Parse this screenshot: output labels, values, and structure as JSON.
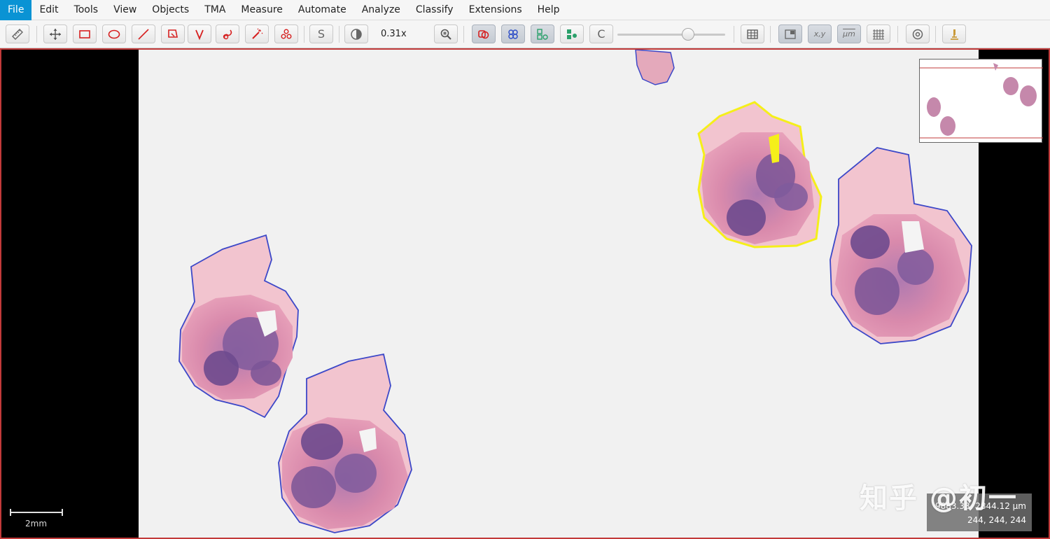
{
  "menu": {
    "items": [
      "File",
      "Edit",
      "Tools",
      "View",
      "Objects",
      "TMA",
      "Measure",
      "Automate",
      "Analyze",
      "Classify",
      "Extensions",
      "Help"
    ]
  },
  "toolbar": {
    "zoom": "0.31x",
    "s_label": "S",
    "c_label": "C",
    "xy_label": "x,y",
    "um_label": "μm",
    "brightness_level": 0.68
  },
  "viewer": {
    "scale_label": "2mm",
    "coord_xy": "9883.33, 2844.12 μm",
    "coord_rgb": "244, 244, 244",
    "watermark": "知乎 @初一"
  },
  "colors": {
    "accent": "#0a93d4",
    "viewer_border": "#c23a3a",
    "annotation_blue": "#3c48c8",
    "annotation_selected": "#f5ef1a",
    "tissue_pink": "#e59ab4",
    "tissue_purple": "#8d5d9e"
  },
  "icons": [
    "ruler-icon",
    "move-icon",
    "rectangle-icon",
    "ellipse-icon",
    "line-icon",
    "polygon-icon",
    "polyline-icon",
    "brush-icon",
    "wand-icon",
    "points-icon",
    "contrast-icon",
    "zoom-fit-icon",
    "annotations-icon",
    "tma-grid-icon",
    "detections-icon",
    "fill-detections-icon",
    "measurement-table-icon",
    "overview-icon",
    "grid-icon",
    "settings-icon",
    "microscope-icon"
  ]
}
